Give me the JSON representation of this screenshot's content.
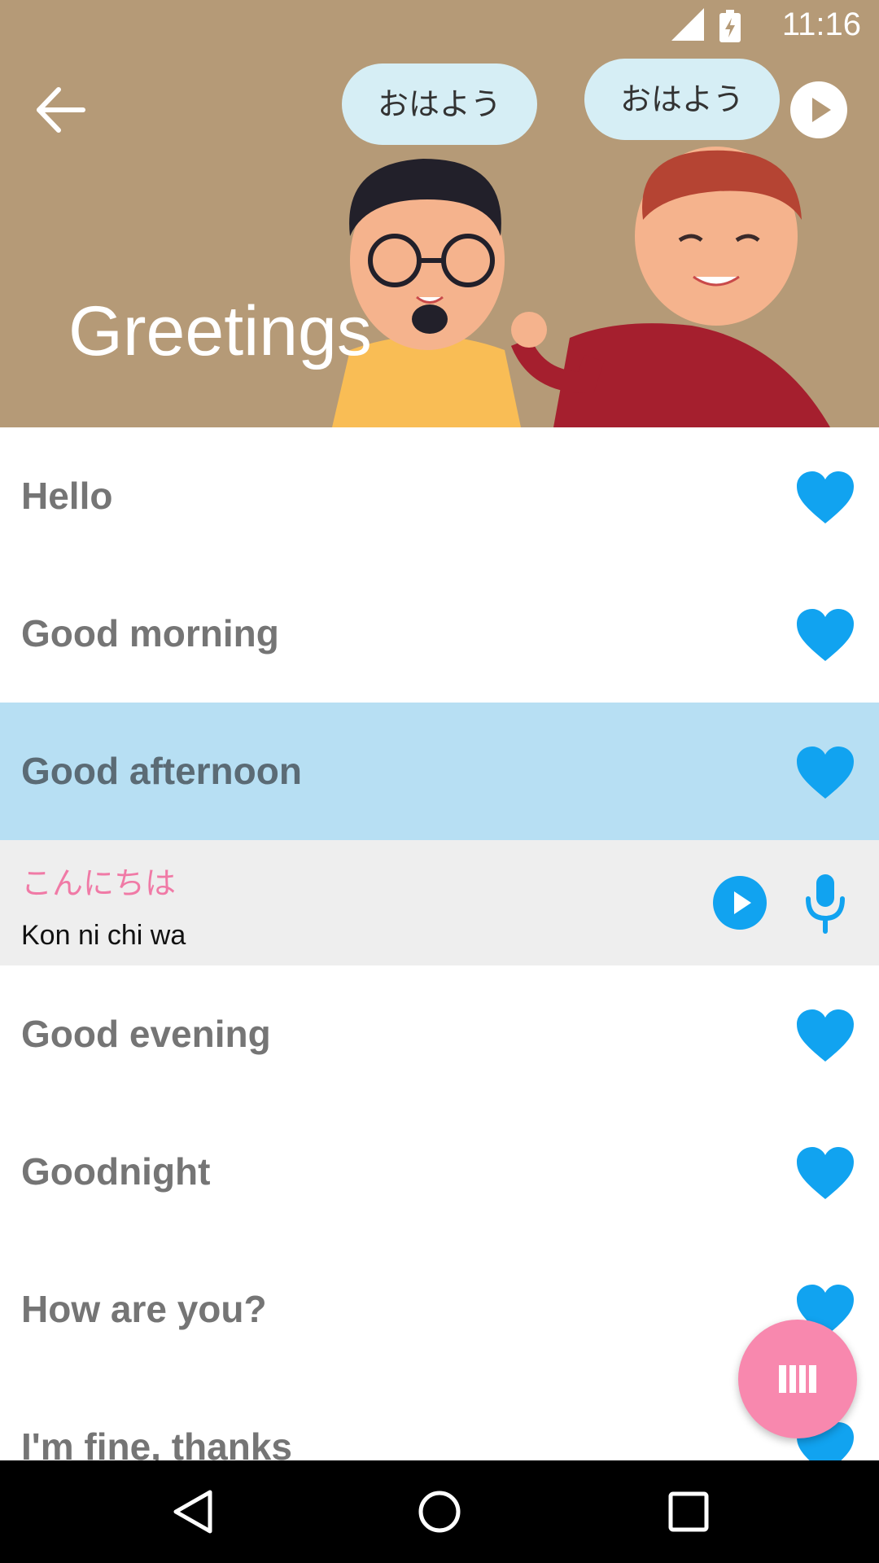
{
  "status": {
    "network": "LTE",
    "time": "11:16"
  },
  "header": {
    "title": "Greetings",
    "bubble_left": "おはよう",
    "bubble_right": "おはよう"
  },
  "phrases": [
    {
      "label": "Hello"
    },
    {
      "label": "Good morning"
    },
    {
      "label": "Good afternoon",
      "active": true
    },
    {
      "label": "Good evening"
    },
    {
      "label": "Goodnight"
    },
    {
      "label": "How are you?"
    },
    {
      "label": "I'm fine, thanks"
    }
  ],
  "detail": {
    "japanese": "こんにちは",
    "romaji": "Kon ni chi wa"
  },
  "colors": {
    "accent": "#11a3f0",
    "header_bg": "#b59a77",
    "active_row": "#b7dff3",
    "fab": "#f888ae",
    "japanese_text": "#f07aa6"
  },
  "icons": [
    "back-arrow-icon",
    "play-icon",
    "heart-icon",
    "microphone-icon",
    "flashcards-icon",
    "nav-back-icon",
    "nav-home-icon",
    "nav-recents-icon"
  ]
}
